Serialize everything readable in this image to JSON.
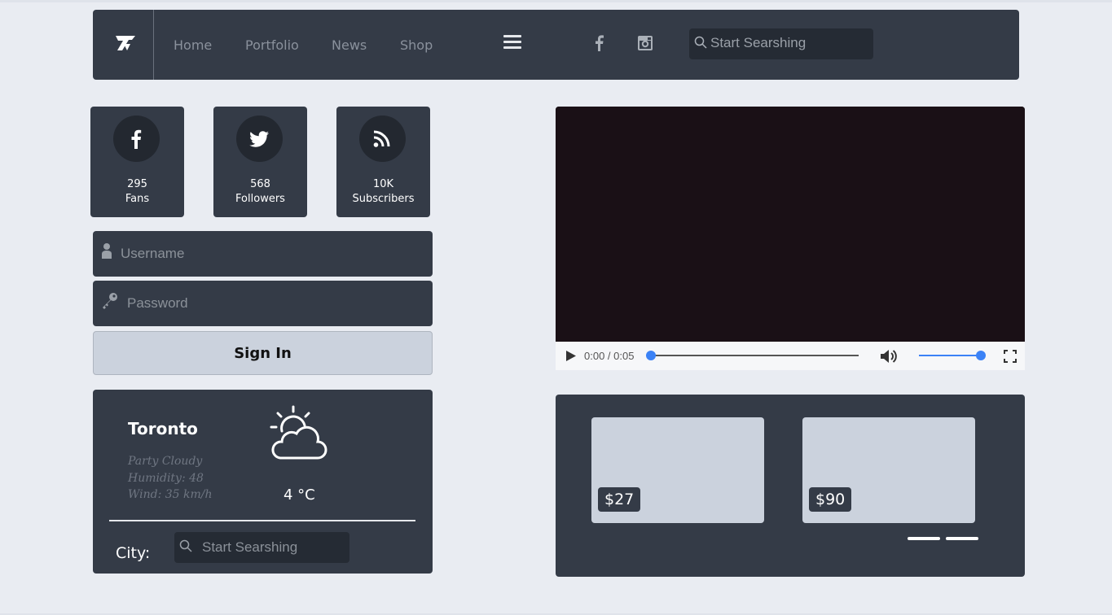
{
  "navbar": {
    "links": [
      "Home",
      "Portfolio",
      "News",
      "Shop"
    ],
    "search_placeholder": "Start Searshing",
    "social_icons": [
      "facebook-icon",
      "instagram-icon"
    ]
  },
  "stats": [
    {
      "icon": "facebook-icon",
      "count": "295",
      "label": "Fans"
    },
    {
      "icon": "twitter-icon",
      "count": "568",
      "label": "Followers"
    },
    {
      "icon": "rss-icon",
      "count": "10K",
      "label": "Subscribers"
    }
  ],
  "login": {
    "username_placeholder": "Username",
    "password_placeholder": "Password",
    "signin_label": "Sign In"
  },
  "weather": {
    "city": "Toronto",
    "condition": "Party Cloudy",
    "humidity": "Humidity: 48",
    "wind": "Wind: 35 km/h",
    "temperature": "4 °C",
    "city_label": "City:",
    "search_placeholder": "Start Searshing"
  },
  "video": {
    "time": "0:00 / 0:05",
    "progress": 0,
    "volume": 1.0
  },
  "products": [
    {
      "price": "$27"
    },
    {
      "price": "$90"
    }
  ],
  "colors": {
    "panel": "#343b47",
    "background": "#e9ecf2",
    "accent": "#3b82f6",
    "light_card": "#cbd2dd"
  }
}
